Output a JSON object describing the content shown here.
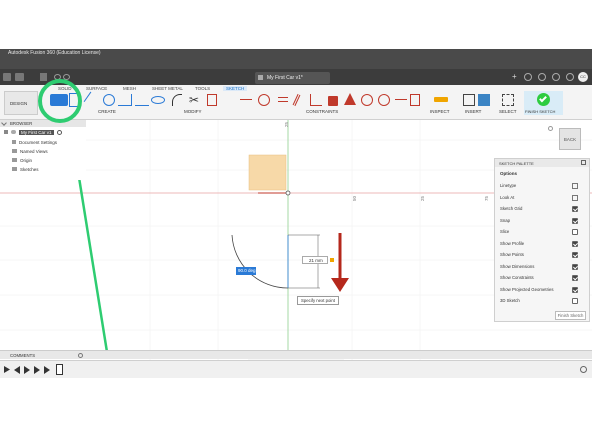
{
  "app": {
    "title": "Autodesk Fusion 360 (Education License)",
    "document_tab": "My First Car v1*",
    "user_initials": "CC"
  },
  "ribbon": {
    "workspace_label": "DESIGN",
    "tabs": [
      "SOLID",
      "SURFACE",
      "MESH",
      "SHEET METAL",
      "TOOLS",
      "SKETCH"
    ],
    "groups": {
      "create": "CREATE",
      "modify": "MODIFY",
      "constraints": "CONSTRAINTS",
      "inspect": "INSPECT",
      "insert": "INSERT",
      "select": "SELECT",
      "finish": "FINISH SKETCH"
    }
  },
  "browser": {
    "header": "BROWSER",
    "root": "My First Car v1",
    "items": [
      "Document Settings",
      "Named Views",
      "Origin",
      "Sketches"
    ]
  },
  "canvas": {
    "axis_labels": [
      "25",
      "50",
      "25",
      "75",
      "50",
      "25"
    ],
    "dimension_value": "21 mm",
    "angle_value": "90.0 deg",
    "tooltip": "Specify next point",
    "viewcube_label": "BACK"
  },
  "palette": {
    "title": "SKETCH PALETTE",
    "section": "Options",
    "rows": [
      {
        "label": "Linetype",
        "type": "icons"
      },
      {
        "label": "Look At",
        "type": "icon"
      },
      {
        "label": "Sketch Grid",
        "checked": true
      },
      {
        "label": "Snap",
        "checked": true
      },
      {
        "label": "Slice",
        "checked": false
      },
      {
        "label": "Show Profile",
        "checked": true
      },
      {
        "label": "Show Points",
        "checked": true
      },
      {
        "label": "Show Dimensions",
        "checked": true
      },
      {
        "label": "Show Constraints",
        "checked": true
      },
      {
        "label": "Show Projected Geometries",
        "checked": true
      },
      {
        "label": "3D Sketch",
        "checked": false
      }
    ],
    "finish_button": "Finish Sketch"
  },
  "comments": {
    "label": "COMMENTS"
  },
  "colors": {
    "accent": "#1a73c8",
    "annotation_green": "#2ecc71",
    "annotation_red": "#b5281c",
    "sketch_blue": "#2a7ad6",
    "profile_fill": "#f7d9a8"
  }
}
